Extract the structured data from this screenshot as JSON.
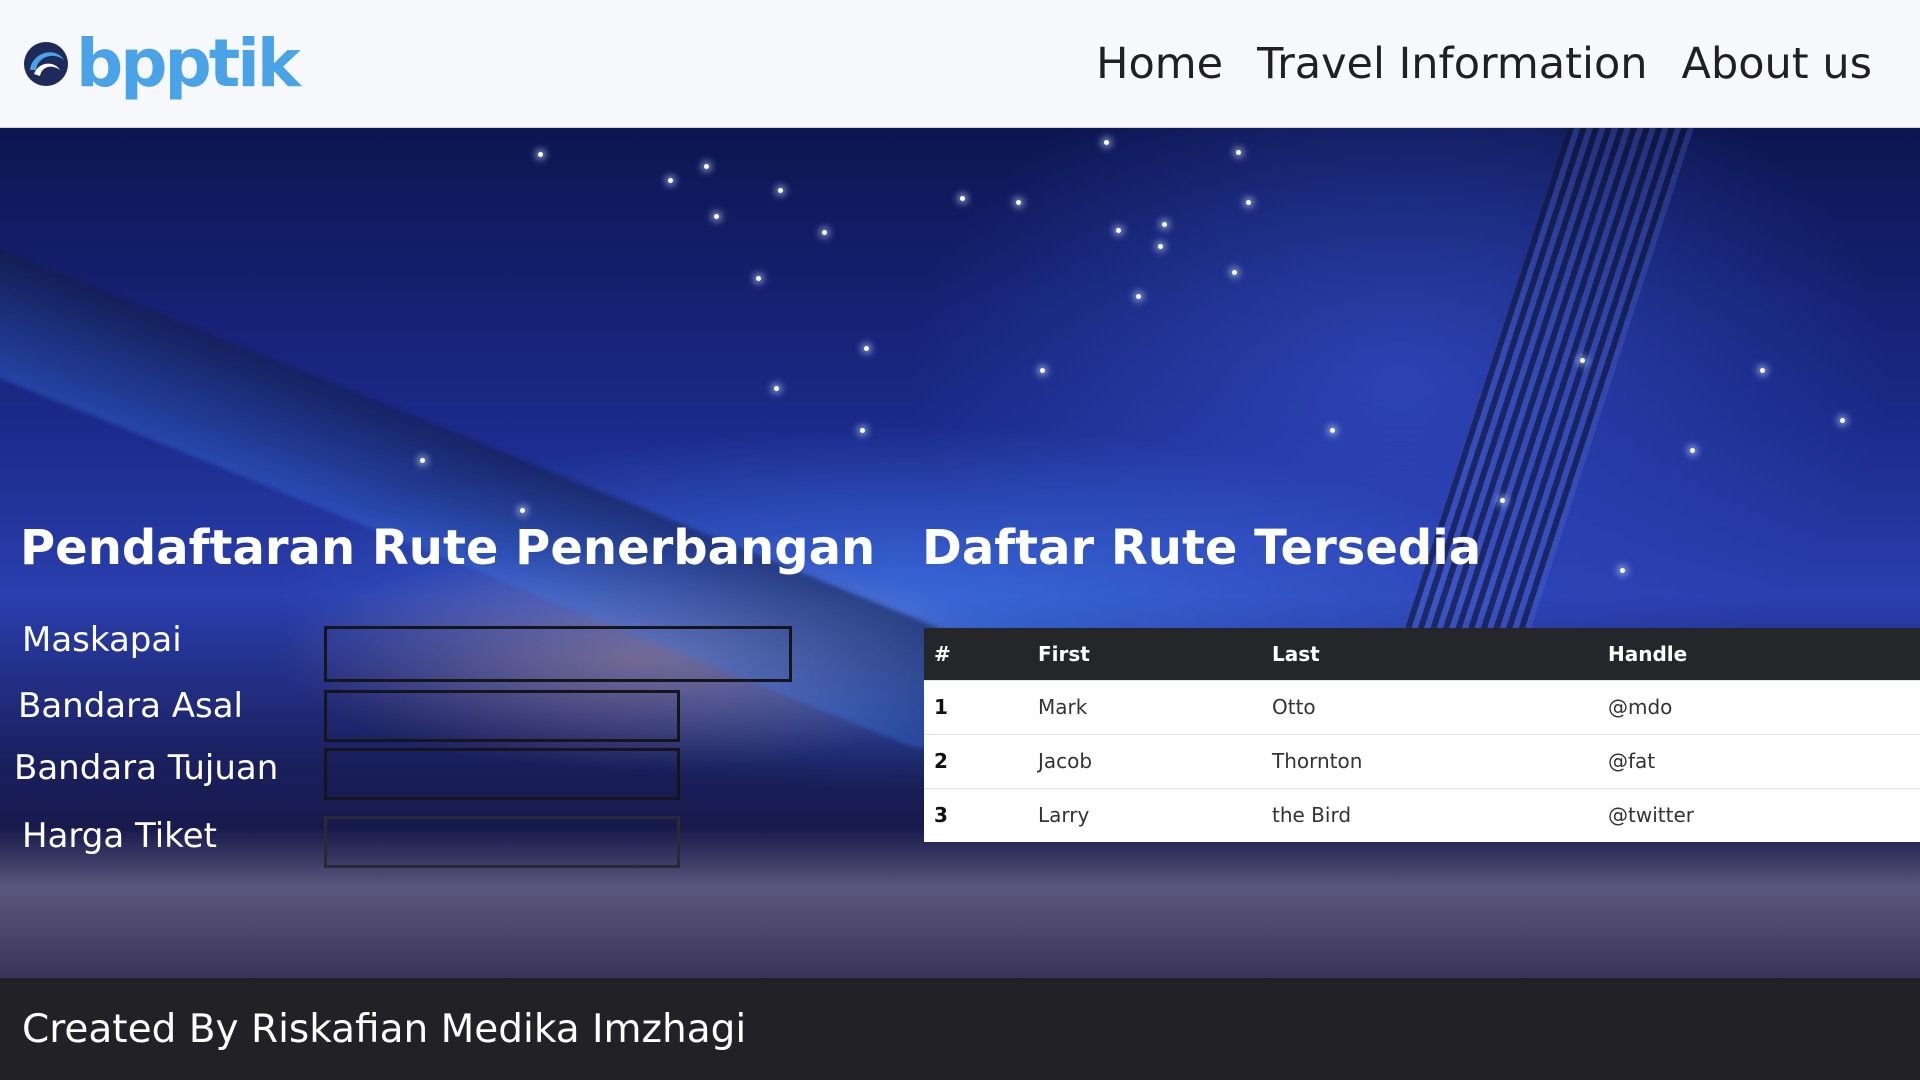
{
  "header": {
    "logo_text": "bpptik",
    "nav": [
      "Home",
      "Travel Information",
      "About us"
    ]
  },
  "form": {
    "title": "Pendaftaran Rute Penerbangan",
    "fields": [
      {
        "label": "Maskapai",
        "value": ""
      },
      {
        "label": "Bandara Asal",
        "value": ""
      },
      {
        "label": "Bandara Tujuan",
        "value": ""
      },
      {
        "label": "Harga Tiket",
        "value": ""
      }
    ]
  },
  "routes": {
    "title": "Daftar Rute Tersedia",
    "columns": [
      "#",
      "First",
      "Last",
      "Handle"
    ],
    "rows": [
      [
        "1",
        "Mark",
        "Otto",
        "@mdo"
      ],
      [
        "2",
        "Jacob",
        "Thornton",
        "@fat"
      ],
      [
        "3",
        "Larry",
        "the Bird",
        "@twitter"
      ]
    ]
  },
  "footer": {
    "text": "Created By Riskafian Medika Imzhagi"
  },
  "colors": {
    "header_bg": "#f7f8fb",
    "logo_blue": "#4aa3e6",
    "table_head_bg": "#25262a",
    "footer_bg": "#222226"
  },
  "icons": {
    "logo": "bpptik-swirl-icon"
  }
}
